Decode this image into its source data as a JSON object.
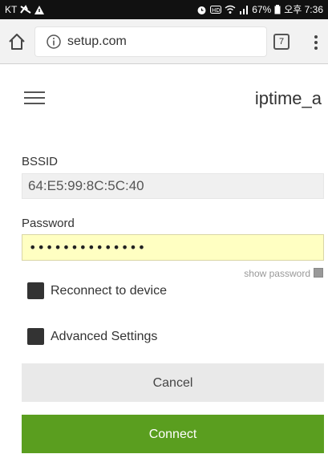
{
  "status_bar": {
    "carrier": "KT",
    "battery": "67%",
    "time": "오후 7:36"
  },
  "browser": {
    "url": "setup.com",
    "tab_count": "7"
  },
  "page": {
    "device_name": "iptime_a",
    "bssid_label": "BSSID",
    "bssid_value": "64:E5:99:8C:5C:40",
    "password_label": "Password",
    "password_value": "••••••••••••••",
    "show_password_label": "show password",
    "reconnect_label": "Reconnect to device",
    "advanced_label": "Advanced Settings",
    "cancel_label": "Cancel",
    "connect_label": "Connect"
  },
  "colors": {
    "connect_button": "#5a9e1f",
    "password_background": "#ffffc2",
    "status_bar": "#111111"
  },
  "icons": [
    "home-icon",
    "info-icon",
    "tabs-icon",
    "more-vert-icon",
    "menu-icon",
    "alarm-icon",
    "hd-icon",
    "wifi-icon",
    "signal-icon",
    "battery-icon",
    "dnd-icon",
    "alert-icon"
  ]
}
